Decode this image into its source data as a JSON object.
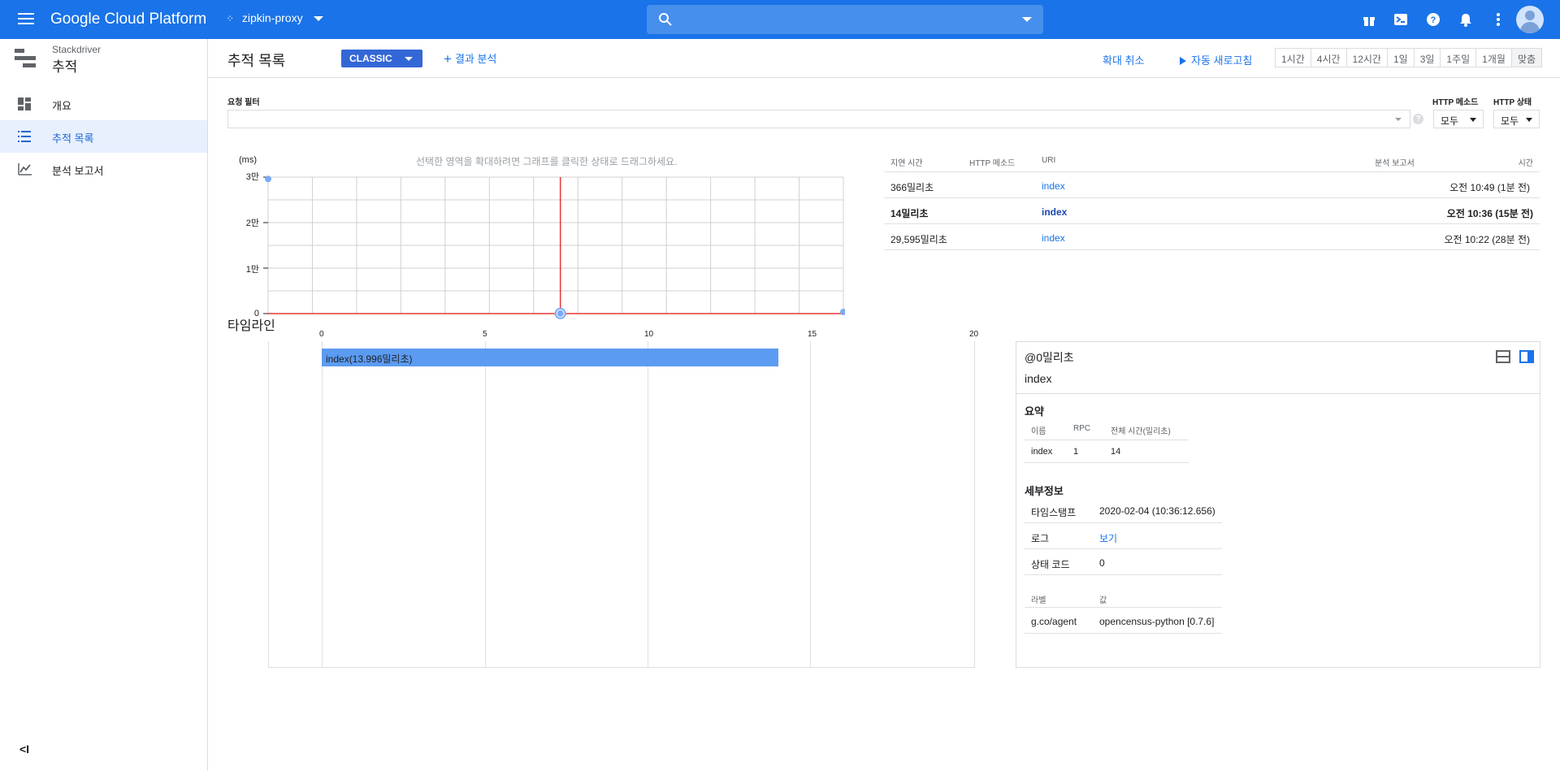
{
  "topbar": {
    "brand": "Google Cloud Platform",
    "project": "zipkin-proxy",
    "search_placeholder": "",
    "icons": [
      "gift-icon",
      "cloud-shell-icon",
      "help-icon",
      "notifications-icon",
      "more-vert-icon",
      "account-avatar"
    ]
  },
  "sidebar": {
    "product_sub": "Stackdriver",
    "product_main": "추적",
    "items": [
      {
        "label": "개요",
        "icon": "dashboard-icon",
        "active": false
      },
      {
        "label": "추적 목록",
        "icon": "list-icon",
        "active": true
      },
      {
        "label": "분석 보고서",
        "icon": "analytics-icon",
        "active": false
      }
    ],
    "collapse_label": "<I"
  },
  "header": {
    "title": "추적 목록",
    "classic_label": "CLASSIC",
    "analysis_label": "결과 분석",
    "zoom_out_label": "확대 취소",
    "auto_refresh_label": "자동 새로고침",
    "ranges": [
      "1시간",
      "4시간",
      "12시간",
      "1일",
      "3일",
      "1주일",
      "1개월",
      "맞춤"
    ]
  },
  "filter": {
    "label": "요청 필터",
    "value": "",
    "http_method_label": "HTTP 메소드",
    "http_method_value": "모두",
    "http_status_label": "HTTP 상태",
    "http_status_value": "모두",
    "help": "?"
  },
  "chart_data": {
    "type": "scatter",
    "hint": "선택한 영역을 확대하려면 그래프를 클릭한 상태로 드래그하세요.",
    "ylabel": "(ms)",
    "ylim": [
      0,
      30000
    ],
    "yticks": [
      {
        "value": 0,
        "label": "0"
      },
      {
        "value": 10000,
        "label": "1만"
      },
      {
        "value": 20000,
        "label": "2만"
      },
      {
        "value": 30000,
        "label": "3만"
      }
    ],
    "xlim": [
      0,
      1
    ],
    "points": [
      {
        "x": 0.0,
        "y": 29595,
        "selected": false
      },
      {
        "x": 0.508,
        "y": 14,
        "selected": true
      },
      {
        "x": 1.0,
        "y": 366,
        "selected": false
      }
    ],
    "colors": {
      "point": "#7baaf7",
      "selected_line": "#e53935",
      "grid": "#d0d0d0"
    }
  },
  "results": {
    "headers": {
      "latency": "지연 시간",
      "method": "HTTP 메소드",
      "uri": "URI",
      "report": "분석 보고서",
      "time": "시간"
    },
    "rows": [
      {
        "latency": "366밀리초",
        "method": "",
        "uri": "index",
        "time": "오전 10:49 (1분 전)",
        "selected": false
      },
      {
        "latency": "14밀리초",
        "method": "",
        "uri": "index",
        "time": "오전 10:36 (15분 전)",
        "selected": true
      },
      {
        "latency": "29,595밀리초",
        "method": "",
        "uri": "index",
        "time": "오전 10:22 (28분 전)",
        "selected": false
      }
    ]
  },
  "timeline": {
    "title": "타임라인",
    "ticks": [
      "0",
      "5",
      "10",
      "15",
      "20"
    ],
    "span": {
      "label": "index(13.996밀리초)",
      "start_ms": 0,
      "duration_ms": 13.996
    }
  },
  "details": {
    "time": "@0밀리초",
    "name": "index",
    "summary_title": "요약",
    "summary_headers": {
      "name": "이름",
      "rpc": "RPC",
      "total": "전체 시간(밀리초)"
    },
    "summary_row": {
      "name": "index",
      "rpc": "1",
      "total": "14"
    },
    "details_title": "세부정보",
    "info": [
      {
        "key": "타임스탬프",
        "value": "2020-02-04 (10:36:12.656)",
        "link": false
      },
      {
        "key": "로그",
        "value": "보기",
        "link": true
      },
      {
        "key": "상태 코드",
        "value": "0",
        "link": false
      }
    ],
    "labels_headers": {
      "key": "라벨",
      "value": "값"
    },
    "labels": [
      {
        "key": "g.co/agent",
        "value": "opencensus-python [0.7.6]"
      }
    ]
  }
}
